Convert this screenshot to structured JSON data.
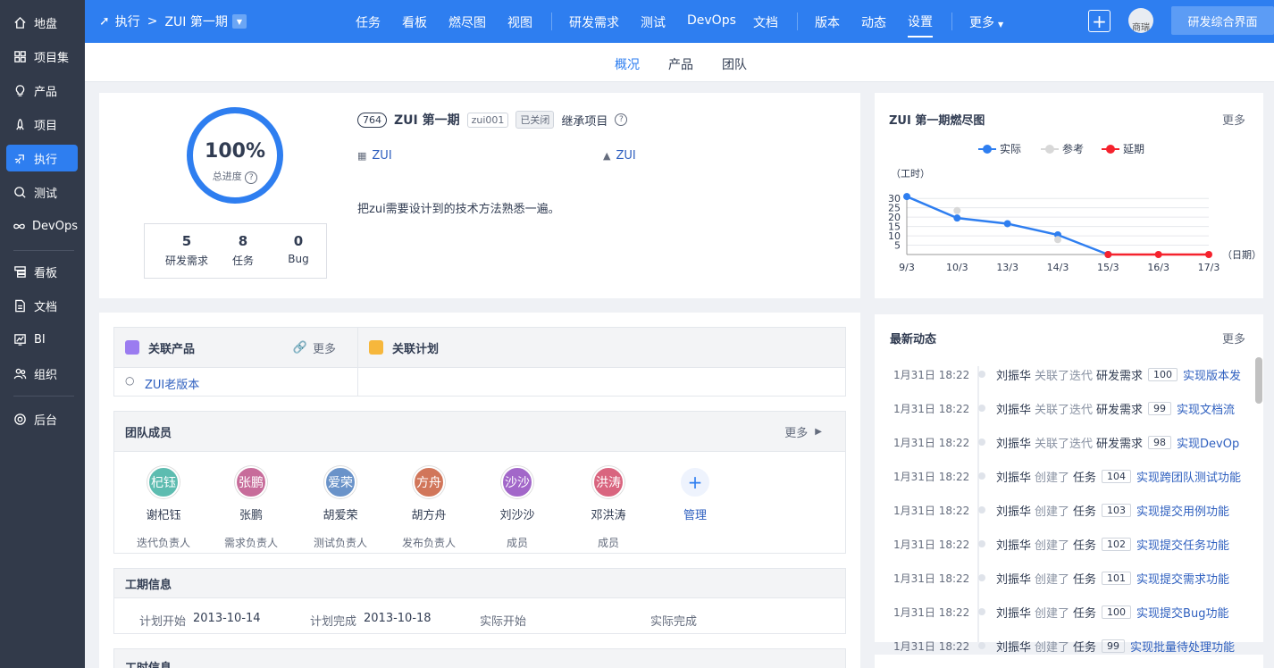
{
  "sidebar": {
    "items": [
      {
        "label": "地盘",
        "icon": "home-icon"
      },
      {
        "label": "项目集",
        "icon": "grid-icon"
      },
      {
        "label": "产品",
        "icon": "bulb-icon"
      },
      {
        "label": "项目",
        "icon": "rocket-icon"
      },
      {
        "label": "执行",
        "icon": "run-icon"
      },
      {
        "label": "测试",
        "icon": "search-icon"
      },
      {
        "label": "DevOps",
        "icon": "infinity-icon"
      },
      {
        "label": "看板",
        "icon": "board-icon"
      },
      {
        "label": "文档",
        "icon": "doc-icon"
      },
      {
        "label": "BI",
        "icon": "chart-icon"
      },
      {
        "label": "组织",
        "icon": "people-icon"
      },
      {
        "label": "后台",
        "icon": "gear-icon"
      }
    ]
  },
  "topbar": {
    "breadcrumb_root": "执行",
    "breadcrumb_current": "ZUI 第一期",
    "nav": [
      "任务",
      "看板",
      "燃尽图",
      "视图",
      "研发需求",
      "测试",
      "DevOps",
      "文档",
      "版本",
      "动态",
      "设置",
      "更多"
    ],
    "avatar_text": "商瑞",
    "rd_button": "研发综合界面"
  },
  "subnav": [
    "概况",
    "产品",
    "团队"
  ],
  "overview": {
    "progress": "100%",
    "progress_label": "总进度",
    "stats": [
      {
        "value": "5",
        "label": "研发需求"
      },
      {
        "value": "8",
        "label": "任务"
      },
      {
        "value": "0",
        "label": "Bug"
      }
    ],
    "id": "764",
    "name": "ZUI 第一期",
    "code": "zui001",
    "status": "已关闭",
    "inherit": "继承项目",
    "program": "ZUI",
    "project": "ZUI",
    "desc": "把zui需要设计到的技术方法熟悉一遍。"
  },
  "burndown": {
    "title": "ZUI 第一期燃尽图",
    "more": "更多",
    "legend": [
      "实际",
      "参考",
      "延期"
    ],
    "unit_y": "（工时）",
    "unit_x": "（日期）"
  },
  "chart_data": {
    "type": "line",
    "categories": [
      "9/3",
      "10/3",
      "13/3",
      "14/3",
      "15/3",
      "16/3",
      "17/3"
    ],
    "yticks": [
      5,
      10,
      15,
      20,
      25,
      30
    ],
    "ylim": [
      0,
      32
    ],
    "series": [
      {
        "name": "实际",
        "color": "#2e7ef0",
        "values": [
          31,
          19.5,
          16.5,
          10.5,
          0,
          null,
          null
        ]
      },
      {
        "name": "参考",
        "color": "#d8d8d8",
        "values": [
          null,
          23.5,
          null,
          8,
          null,
          null,
          null
        ]
      },
      {
        "name": "延期",
        "color": "#f5222d",
        "values": [
          null,
          null,
          null,
          null,
          0,
          0,
          0
        ]
      }
    ]
  },
  "linked": {
    "product_title": "关联产品",
    "more": "更多",
    "plan_title": "关联计划",
    "product_item": "ZUI老版本"
  },
  "team": {
    "title": "团队成员",
    "more": "更多",
    "members": [
      {
        "avatar": "杞钰",
        "name": "谢杞钰",
        "role": "迭代负责人",
        "color": "#5dbcb0"
      },
      {
        "avatar": "张鹏",
        "name": "张鹏",
        "role": "需求负责人",
        "color": "#c76c9a"
      },
      {
        "avatar": "爱荣",
        "name": "胡爱荣",
        "role": "测试负责人",
        "color": "#6a93c9"
      },
      {
        "avatar": "方舟",
        "name": "胡方舟",
        "role": "发布负责人",
        "color": "#d1765a"
      },
      {
        "avatar": "沙沙",
        "name": "刘沙沙",
        "role": "成员",
        "color": "#a267c9"
      },
      {
        "avatar": "洪涛",
        "name": "邓洪涛",
        "role": "成员",
        "color": "#d9657f"
      }
    ],
    "manage": "管理"
  },
  "period": {
    "title": "工期信息",
    "plan_start_label": "计划开始",
    "plan_start": "2013-10-14",
    "plan_end_label": "计划完成",
    "plan_end": "2013-10-18",
    "real_start_label": "实际开始",
    "real_end_label": "实际完成"
  },
  "hours": {
    "title": "工时信息"
  },
  "activity": {
    "title": "最新动态",
    "more": "更多",
    "items": [
      {
        "time": "1月31日 18:22",
        "user": "刘振华",
        "action": "关联了迭代",
        "type": "研发需求",
        "id": "100",
        "target": "实现版本发"
      },
      {
        "time": "1月31日 18:22",
        "user": "刘振华",
        "action": "关联了迭代",
        "type": "研发需求",
        "id": "99",
        "target": "实现文档流"
      },
      {
        "time": "1月31日 18:22",
        "user": "刘振华",
        "action": "关联了迭代",
        "type": "研发需求",
        "id": "98",
        "target": "实现DevOp"
      },
      {
        "time": "1月31日 18:22",
        "user": "刘振华",
        "action": "创建了",
        "type": "任务",
        "id": "104",
        "target": "实现跨团队测试功能"
      },
      {
        "time": "1月31日 18:22",
        "user": "刘振华",
        "action": "创建了",
        "type": "任务",
        "id": "103",
        "target": "实现提交用例功能"
      },
      {
        "time": "1月31日 18:22",
        "user": "刘振华",
        "action": "创建了",
        "type": "任务",
        "id": "102",
        "target": "实现提交任务功能"
      },
      {
        "time": "1月31日 18:22",
        "user": "刘振华",
        "action": "创建了",
        "type": "任务",
        "id": "101",
        "target": "实现提交需求功能"
      },
      {
        "time": "1月31日 18:22",
        "user": "刘振华",
        "action": "创建了",
        "type": "任务",
        "id": "100",
        "target": "实现提交Bug功能"
      },
      {
        "time": "1月31日 18:22",
        "user": "刘振华",
        "action": "创建了",
        "type": "任务",
        "id": "99",
        "target": "实现批量待处理功能"
      }
    ]
  }
}
